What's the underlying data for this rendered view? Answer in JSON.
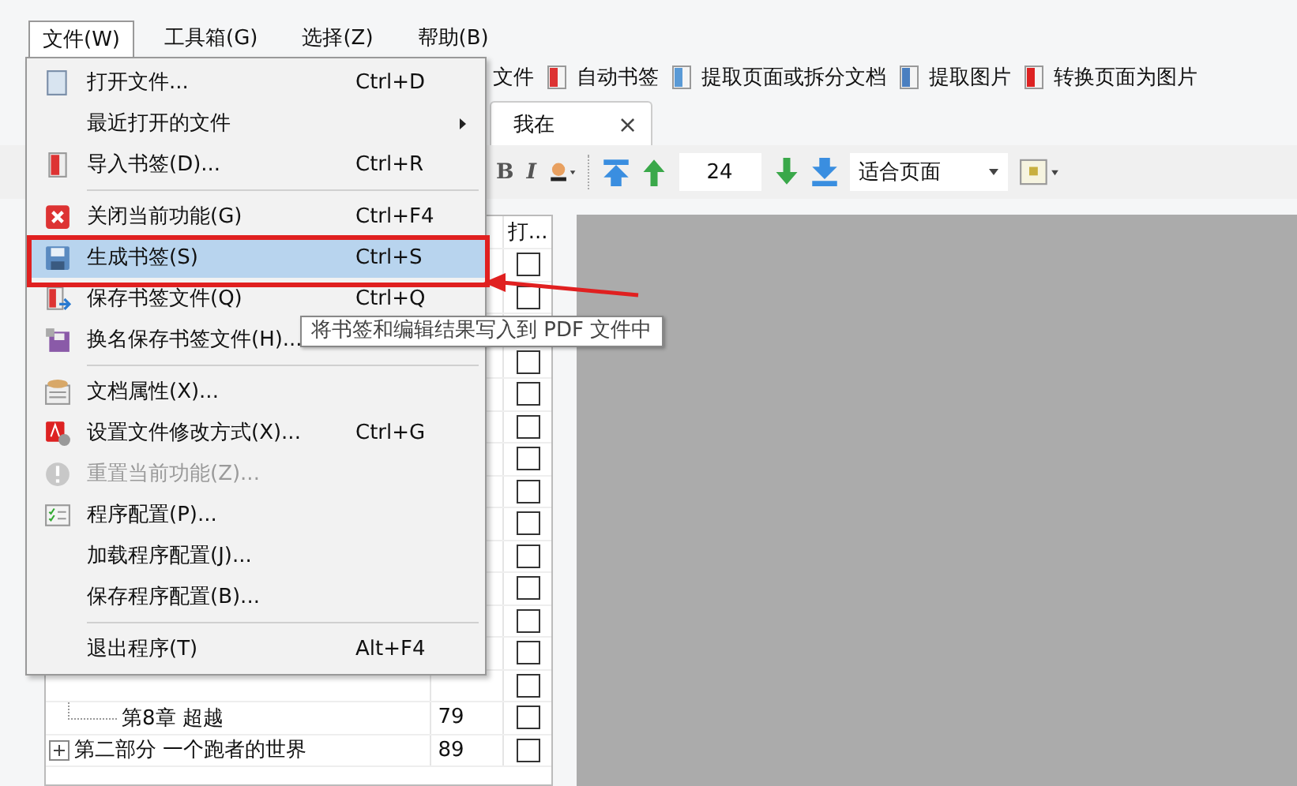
{
  "menubar": [
    {
      "label": "文件(W)",
      "selected": true
    },
    {
      "label": "工具箱(G)",
      "selected": false
    },
    {
      "label": "选择(Z)",
      "selected": false
    },
    {
      "label": "帮助(B)",
      "selected": false
    }
  ],
  "toolbar": [
    {
      "label": "文件"
    },
    {
      "label": "自动书签"
    },
    {
      "label": "提取页面或拆分文档"
    },
    {
      "label": "提取图片"
    },
    {
      "label": "转换页面为图片"
    }
  ],
  "tab": {
    "label": "我在",
    "close": "×"
  },
  "format_toolbar": {
    "bold": "B",
    "italic": "I",
    "page": "24",
    "zoom": "适合页面"
  },
  "bookmarks": {
    "column_3": "打...",
    "rows": [
      {
        "checked": false
      },
      {
        "checked": false
      },
      {
        "kind": "covered"
      },
      {
        "checked": false
      },
      {
        "checked": false
      },
      {
        "checked": false
      },
      {
        "checked": false
      },
      {
        "checked": false
      },
      {
        "checked": false
      },
      {
        "checked": false
      },
      {
        "checked": false
      },
      {
        "checked": false
      },
      {
        "checked": false
      },
      {
        "checked": false
      },
      {
        "kind": "chapter",
        "title": "第8章  超越",
        "page": "79",
        "checked": false
      },
      {
        "kind": "part",
        "title": "第二部分  一个跑者的世界",
        "page": "89",
        "checked": false
      }
    ]
  },
  "file_menu": [
    {
      "label": "打开文件...",
      "shortcut": "Ctrl+D",
      "selected": false,
      "disabled": false
    },
    {
      "label": "最近打开的文件",
      "submenu": true,
      "selected": false,
      "disabled": false
    },
    {
      "label": "导入书签(D)...",
      "shortcut": "Ctrl+R",
      "selected": false,
      "disabled": false,
      "separator_after": true
    },
    {
      "label": "关闭当前功能(G)",
      "shortcut": "Ctrl+F4",
      "selected": false,
      "disabled": false
    },
    {
      "label": "生成书签(S)",
      "shortcut": "Ctrl+S",
      "selected": true,
      "disabled": false
    },
    {
      "label": "保存书签文件(Q)",
      "shortcut": "Ctrl+Q",
      "selected": false,
      "disabled": false
    },
    {
      "label": "换名保存书签文件(H)...",
      "selected": false,
      "disabled": false,
      "separator_after": true
    },
    {
      "label": "文档属性(X)...",
      "selected": false,
      "disabled": false
    },
    {
      "label": "设置文件修改方式(X)...",
      "shortcut": "Ctrl+G",
      "selected": false,
      "disabled": false
    },
    {
      "label": "重置当前功能(Z)...",
      "selected": false,
      "disabled": true
    },
    {
      "label": "程序配置(P)...",
      "selected": false,
      "disabled": false
    },
    {
      "label": "加载程序配置(J)...",
      "selected": false,
      "disabled": false
    },
    {
      "label": "保存程序配置(B)...",
      "selected": false,
      "disabled": false,
      "separator_after": true
    },
    {
      "label": "退出程序(T)",
      "shortcut": "Alt+F4",
      "selected": false,
      "disabled": false
    }
  ],
  "tooltip": "将书签和编辑结果写入到 PDF 文件中"
}
